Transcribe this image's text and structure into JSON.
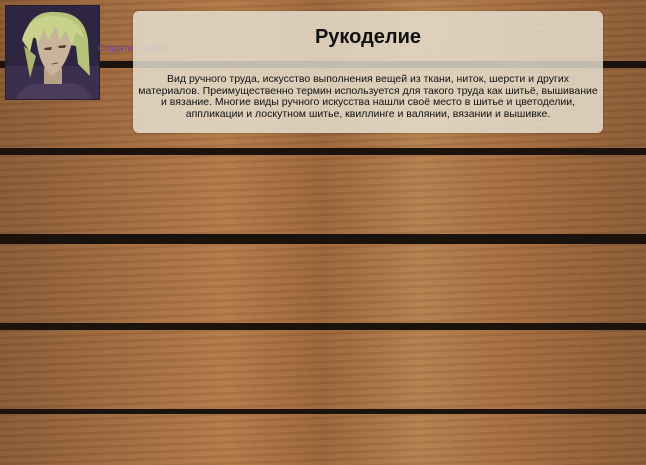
{
  "page": {
    "title": "Рукоделие",
    "creator_link": "Создатель сайта",
    "description": "Вид ручного труда, искусство выполнения вещей из ткани, ниток, шерсти и других материалов. Преимущественно термин используется для такого труда как шитьё, вышивание и вязание. Многие виды ручного искусства нашли своё место в шитье и цветоделии, аппликации и лоскутном шитье, квиллинге и валянии, вязании и вышивке."
  },
  "colors": {
    "panel": "#e8e2d2",
    "link": "#6a3fa0",
    "text": "#111111",
    "wood": "#a06a3e",
    "gap": "#1b120c"
  },
  "icons": {
    "avatar": "anime-character-avatar"
  }
}
